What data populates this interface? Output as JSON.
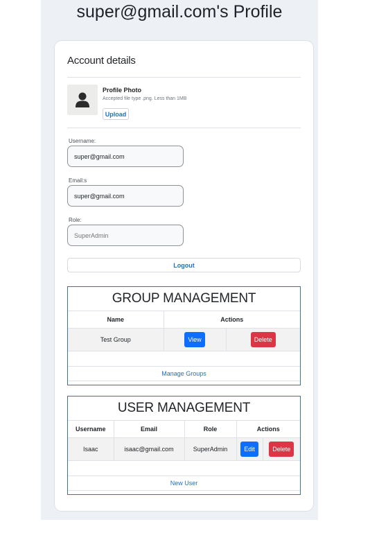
{
  "page": {
    "title": "super@gmail.com's Profile"
  },
  "account": {
    "section_title": "Account details",
    "photo_label": "Profile Photo",
    "photo_help": "Accepted file type .png. Less than 1MB",
    "upload_label": "Upload",
    "username_label": "Username:",
    "username_value": "super@gmail.com",
    "email_label": "Email:s",
    "email_value": "super@gmail.com",
    "role_label": "Role:",
    "role_placeholder": "SuperAdmin",
    "logout_label": "Logout"
  },
  "groups": {
    "title": "GROUP MANAGEMENT",
    "columns": [
      "Name",
      "Actions"
    ],
    "rows": [
      {
        "name": "Test Group",
        "view_label": "View",
        "delete_label": "Delete"
      }
    ],
    "manage_label": "Manage Groups"
  },
  "users": {
    "title": "USER MANAGEMENT",
    "columns": [
      "Username",
      "Email",
      "Role",
      "Actions"
    ],
    "rows": [
      {
        "username": "Isaac",
        "email": "isaac@gmail.com",
        "role": "SuperAdmin",
        "edit_label": "Edit",
        "delete_label": "Delete"
      }
    ],
    "new_label": "New User"
  },
  "colors": {
    "primary": "#0d6efd",
    "danger": "#dc3545",
    "link": "#1d6fc4",
    "box_border": "#3d6fb5"
  }
}
